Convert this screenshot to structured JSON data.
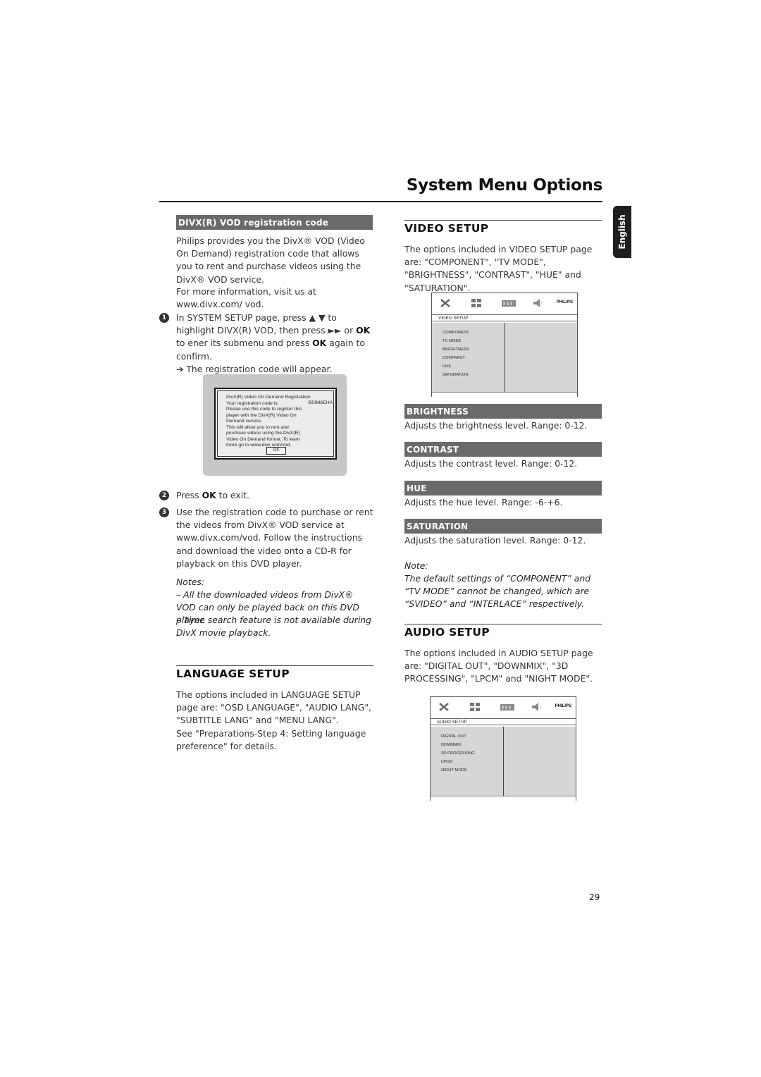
{
  "page": {
    "title": "System Menu Options",
    "language_tab": "English",
    "page_number": "29"
  },
  "divx": {
    "heading": "DIVX(R) VOD registration code",
    "intro_1": "Philips provides you the DivX® VOD (Video On Demand) registration code that allows you to rent and purchase videos using the DivX® VOD service.",
    "intro_2": "For more information, visit us at www.divx.com/ vod.",
    "step1": {
      "num": "1",
      "text_a": "In SYSTEM SETUP page, press ▲ ▼ to highlight DIVX(R) VOD, then press ►►  or ",
      "ok": "OK",
      "text_b": " to ener its submenu and press ",
      "ok2": "OK",
      "text_c": " again to confirm.",
      "result": "➔ The registration code will appear."
    },
    "dialog": {
      "lines": [
        "DivX(R) Video On Demand Registration",
        "Your registration code is:",
        "Please use this code to register this",
        "player with the DivX(R) Video On",
        "Demand service.",
        "This will allow you to rent and",
        "pruchase videos using the DivX(R)",
        "Video On Demand format. To learn",
        "more go to www.divx.com/vod."
      ],
      "code": "BSIM8EHA",
      "ok_button": "OK"
    },
    "step2": {
      "num": "2",
      "text_a": "Press ",
      "ok": "OK",
      "text_b": " to exit."
    },
    "step3": {
      "num": "3",
      "text": "Use the registration code to purchase or rent the videos from DivX® VOD service at www.divx.com/vod. Follow the instructions and download the video onto a CD-R for playback on this DVD player."
    },
    "notes_label": "Notes:",
    "notes": [
      "–  All the downloaded videos from DivX® VOD can only be played back on this DVD player.",
      "–  Time search feature is not available during DivX movie playback."
    ]
  },
  "language_setup": {
    "heading": "LANGUAGE SETUP",
    "text_1": "The options included in LANGUAGE SETUP page are: \"OSD LANGUAGE\", \"AUDIO LANG\", \"SUBTITLE LANG\" and \"MENU LANG\".",
    "text_2": "See \"Preparations-Step 4: Setting language preference\" for details."
  },
  "video_setup": {
    "heading": "VIDEO SETUP",
    "text": "The options included in VIDEO SETUP page are: \"COMPONENT\", \"TV MODE\", \"BRIGHTNESS\", \"CONTRAST\", \"HUE\" and \"SATURATION\".",
    "screen": {
      "brand": "PHILIPS",
      "label": "VIDEO SETUP",
      "items": [
        "COMPONENT",
        "TV MODE",
        "BRIGHTNESS",
        "CONTRAST",
        "HUE",
        "SATURATION"
      ],
      "icons": [
        "tools-icon",
        "grid-icon",
        "film-icon",
        "speaker-icon"
      ]
    },
    "options": [
      {
        "title": "BRIGHTNESS",
        "desc": "Adjusts the brightness level. Range: 0-12."
      },
      {
        "title": "CONTRAST",
        "desc": "Adjusts the contrast level. Range: 0-12."
      },
      {
        "title": "HUE",
        "desc": "Adjusts the hue level. Range: -6-+6."
      },
      {
        "title": "SATURATION",
        "desc": "Adjusts the saturation level. Range: 0-12."
      }
    ],
    "note_label": "Note:",
    "note": "The default settings of “COMPONENT” and “TV MODE” cannot be changed, which are “SVIDEO” and “INTERLACE” respectively."
  },
  "audio_setup": {
    "heading": "AUDIO SETUP",
    "text": "The options included in AUDIO SETUP page are: \"DIGITAL OUT\", \"DOWNMIX\", \"3D PROCESSING\", \"LPCM\" and \"NIGHT MODE\".",
    "screen": {
      "brand": "PHILIPS",
      "label": "AUDIO SETUP",
      "items": [
        "DIGITAL OUT",
        "DOWNMIX",
        "3D PROCESSING",
        "LPCM",
        "NIGHT MODE"
      ]
    }
  },
  "colors": {
    "section_bar": "#6a6a6a",
    "tab": "#1e1e1e",
    "osd_pane": "#d6d6d6"
  }
}
